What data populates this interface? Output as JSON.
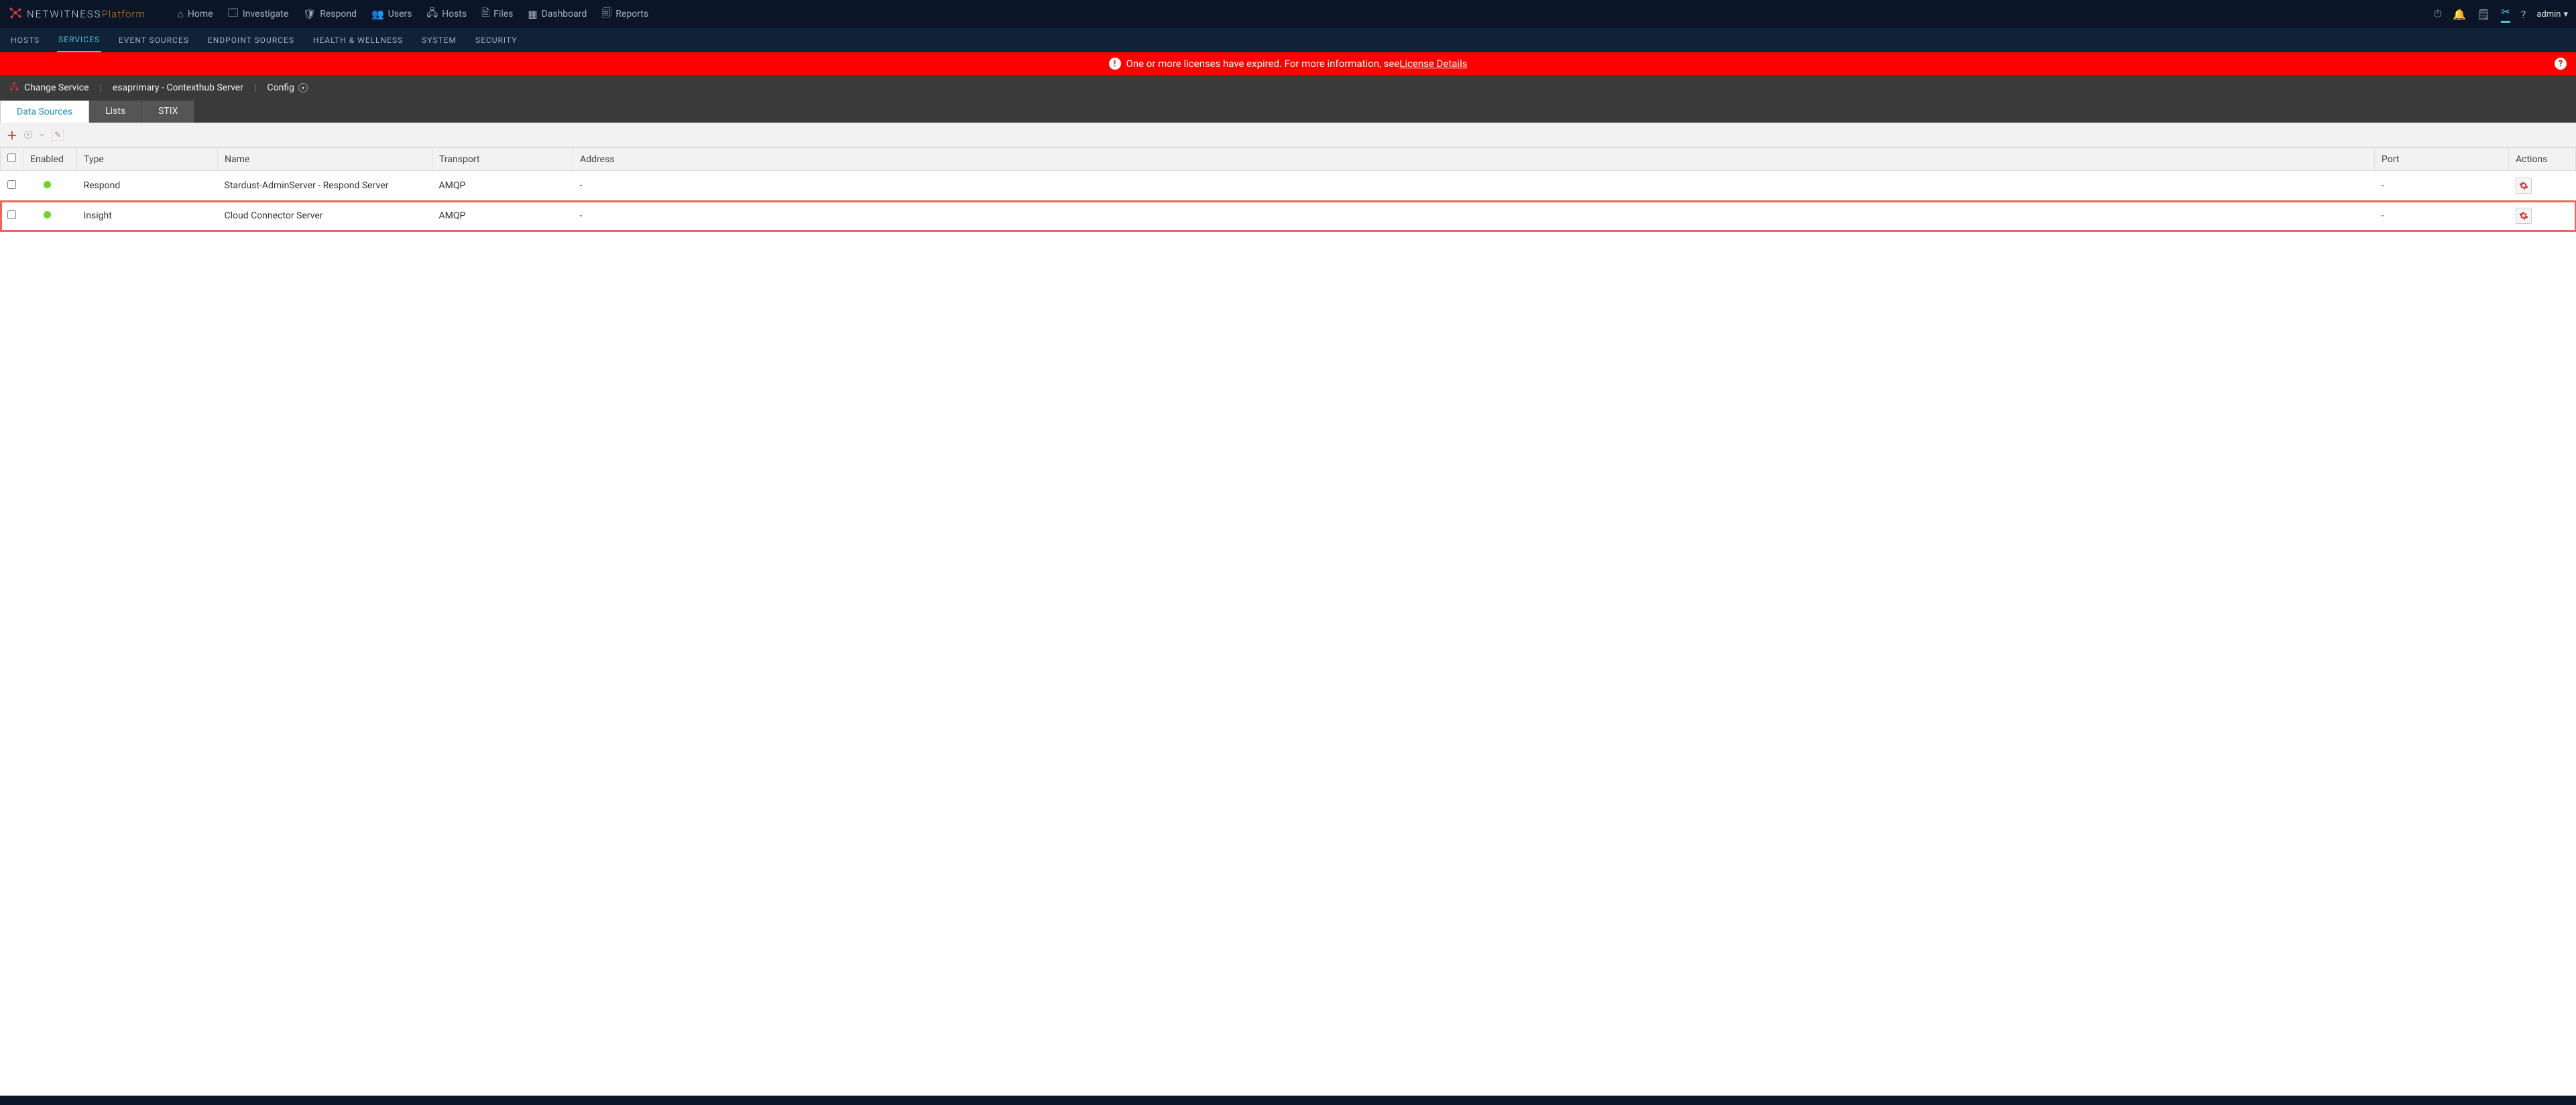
{
  "brand": {
    "name": "NETWITNESS",
    "suffix": "Platform"
  },
  "topnav": [
    {
      "label": "Home"
    },
    {
      "label": "Investigate"
    },
    {
      "label": "Respond"
    },
    {
      "label": "Users"
    },
    {
      "label": "Hosts"
    },
    {
      "label": "Files"
    },
    {
      "label": "Dashboard"
    },
    {
      "label": "Reports"
    }
  ],
  "user": "admin",
  "subnav": [
    {
      "label": "HOSTS"
    },
    {
      "label": "SERVICES",
      "active": true
    },
    {
      "label": "EVENT SOURCES"
    },
    {
      "label": "ENDPOINT SOURCES"
    },
    {
      "label": "HEALTH & WELLNESS"
    },
    {
      "label": "SYSTEM"
    },
    {
      "label": "SECURITY"
    }
  ],
  "alert": {
    "text": "One or more licenses have expired. For more information, see ",
    "link": "License Details"
  },
  "servicebar": {
    "change": "Change Service",
    "service": "esaprimary - Contexthub Server",
    "page": "Config"
  },
  "tabs": [
    {
      "label": "Data Sources",
      "active": true
    },
    {
      "label": "Lists"
    },
    {
      "label": "STIX"
    }
  ],
  "columns": {
    "enabled": "Enabled",
    "type": "Type",
    "name": "Name",
    "transport": "Transport",
    "address": "Address",
    "port": "Port",
    "actions": "Actions"
  },
  "rows": [
    {
      "type": "Respond",
      "name": "Stardust-AdminServer - Respond Server",
      "transport": "AMQP",
      "address": "-",
      "port": "-",
      "highlight": false
    },
    {
      "type": "Insight",
      "name": "Cloud Connector Server",
      "transport": "AMQP",
      "address": "-",
      "port": "-",
      "highlight": true
    }
  ]
}
